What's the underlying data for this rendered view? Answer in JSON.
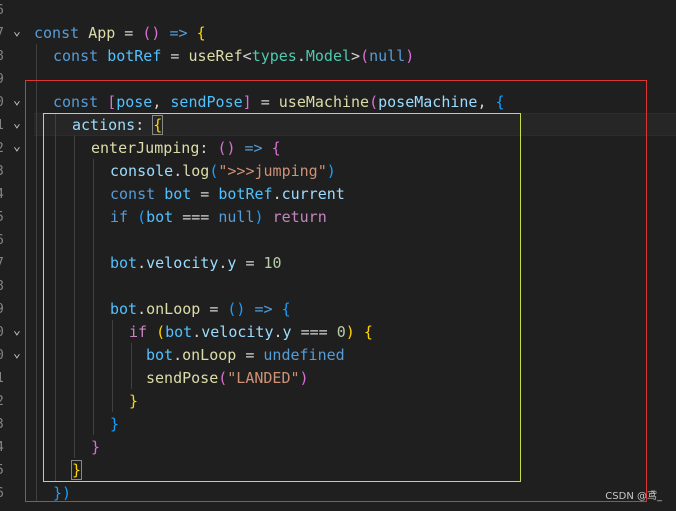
{
  "gutter": {
    "line_numbers": [
      "6",
      "7",
      "8",
      "9",
      "0",
      "1",
      "2",
      "3",
      "4",
      "5",
      "6",
      "7",
      "8",
      "9",
      "0",
      "0",
      "1",
      "2",
      "3",
      "4",
      "5",
      "6"
    ],
    "fold_arrows": [
      "",
      "⌄",
      "",
      "",
      "⌄",
      "⌄",
      "⌄",
      "",
      "",
      "",
      "",
      "",
      "",
      "",
      "⌄",
      "⌄",
      "",
      "",
      "",
      "",
      "",
      ""
    ]
  },
  "code": {
    "l1": {
      "t1": "const",
      "t2": "App",
      "t3": " = ",
      "t4": "()",
      "t5": " => ",
      "t6": "{"
    },
    "l2": {
      "t1": "const",
      "t2": "botRef",
      "t3": " = ",
      "t4": "useRef",
      "t5": "<",
      "t6": "types",
      "t7": ".",
      "t8": "Model",
      "t9": ">",
      "t10": "(",
      "t11": "null",
      "t12": ")"
    },
    "l3": {},
    "l4": {
      "t1": "const",
      "t2": "[",
      "t3": "pose",
      "t4": ", ",
      "t5": "sendPose",
      "t6": "]",
      "t7": " = ",
      "t8": "useMachine",
      "t9": "(",
      "t10": "poseMachine",
      "t11": ", ",
      "t12": "{"
    },
    "l5": {
      "t1": "actions",
      "t2": ": ",
      "t3": "{"
    },
    "l6": {
      "t1": "enterJumping",
      "t2": ": ",
      "t3": "()",
      "t4": " => ",
      "t5": "{"
    },
    "l7": {
      "t1": "console",
      "t2": ".",
      "t3": "log",
      "t4": "(",
      "t5": "\">>>jumping\"",
      "t6": ")"
    },
    "l8": {
      "t1": "const",
      "t2": "bot",
      "t3": " = ",
      "t4": "botRef",
      "t5": ".",
      "t6": "current"
    },
    "l9": {
      "t1": "if",
      "t2": " (",
      "t3": "bot",
      "t4": " === ",
      "t5": "null",
      "t6": ") ",
      "t7": "return"
    },
    "l10": {},
    "l11": {
      "t1": "bot",
      "t2": ".",
      "t3": "velocity",
      "t4": ".",
      "t5": "y",
      "t6": " = ",
      "t7": "10"
    },
    "l12": {},
    "l13": {
      "t1": "bot",
      "t2": ".",
      "t3": "onLoop",
      "t4": " = ",
      "t5": "()",
      "t6": " => ",
      "t7": "{"
    },
    "l14": {
      "t1": "if",
      "t2": " (",
      "t3": "bot",
      "t4": ".",
      "t5": "velocity",
      "t6": ".",
      "t7": "y",
      "t8": " === ",
      "t9": "0",
      "t10": ") ",
      "t11": "{"
    },
    "l15": {
      "t1": "bot",
      "t2": ".",
      "t3": "onLoop",
      "t4": " = ",
      "t5": "undefined"
    },
    "l16": {
      "t1": "sendPose",
      "t2": "(",
      "t3": "\"LANDED\"",
      "t4": ")"
    },
    "l17": {
      "t1": "}"
    },
    "l18": {
      "t1": "}"
    },
    "l19": {
      "t1": "}"
    },
    "l20": {
      "t1": "}"
    },
    "l21": {
      "t1": "})"
    }
  },
  "watermark": "CSDN @鸢_",
  "colors": {
    "background": "#1f1f1f",
    "red_box": "#e03333",
    "yellow_box": "#c8dc46",
    "keyword": "#569cd6",
    "function": "#dcdcaa",
    "variable": "#9cdcfe",
    "string": "#ce9178",
    "number": "#b5cea8"
  }
}
